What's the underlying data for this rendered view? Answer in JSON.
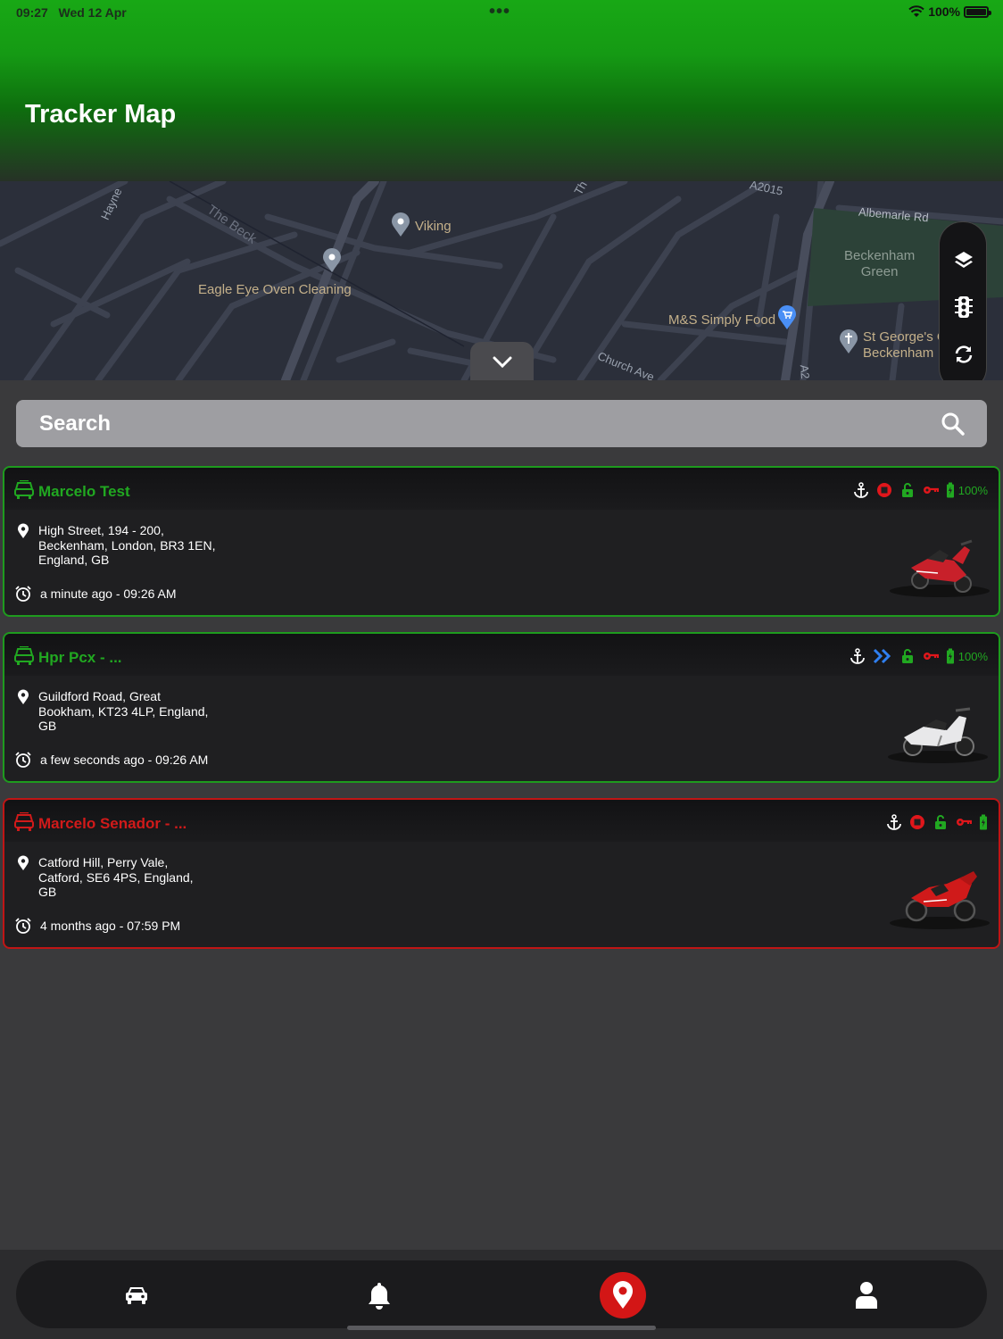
{
  "status_bar": {
    "time": "09:27",
    "date": "Wed 12 Apr",
    "battery": "100%"
  },
  "header": {
    "title": "Tracker Map"
  },
  "map": {
    "labels": {
      "hayne": "Hayne",
      "the_beck": "The Beck",
      "viking": "Viking",
      "eagle_eye": "Eagle Eye Oven Cleaning",
      "ms_food": "M&S Simply Food",
      "beckenham_green": "Beckenham\nGreen",
      "albemarle": "Albemarle Rd",
      "st_georges": "St George's Church,\nBeckenham",
      "church_ave": "Church Ave",
      "a2015": "A2015",
      "a2": "A2",
      "road_th": "Th"
    },
    "controls": [
      "layers-icon",
      "traffic-light-icon",
      "refresh-icon"
    ]
  },
  "search": {
    "placeholder": "Search"
  },
  "vehicles": [
    {
      "name": "Marcelo Test",
      "address": "High Street, 194 - 200, Beckenham, London, BR3 1EN, England, GB",
      "time": "a minute ago - 09:26 AM",
      "battery": "100%",
      "state": "ok",
      "motion": "stopped",
      "color": "#21a821"
    },
    {
      "name": "Hpr Pcx - ...",
      "address": "Guildford Road, Great Bookham, KT23 4LP, England, GB",
      "time": "a few seconds ago - 09:26 AM",
      "battery": "100%",
      "state": "ok",
      "motion": "moving",
      "color": "#21a821"
    },
    {
      "name": "Marcelo Senador - ...",
      "address": "Catford Hill, Perry Vale, Catford, SE6 4PS, England, GB",
      "time": "4 months ago - 07:59 PM",
      "battery": "",
      "state": "alert",
      "motion": "stopped",
      "color": "#d11a1a"
    }
  ],
  "tabbar": {
    "tabs": [
      "car-icon",
      "bell-icon",
      "map-pin-icon",
      "user-icon"
    ],
    "active": "map-pin-icon",
    "active_color": "#d31616"
  }
}
